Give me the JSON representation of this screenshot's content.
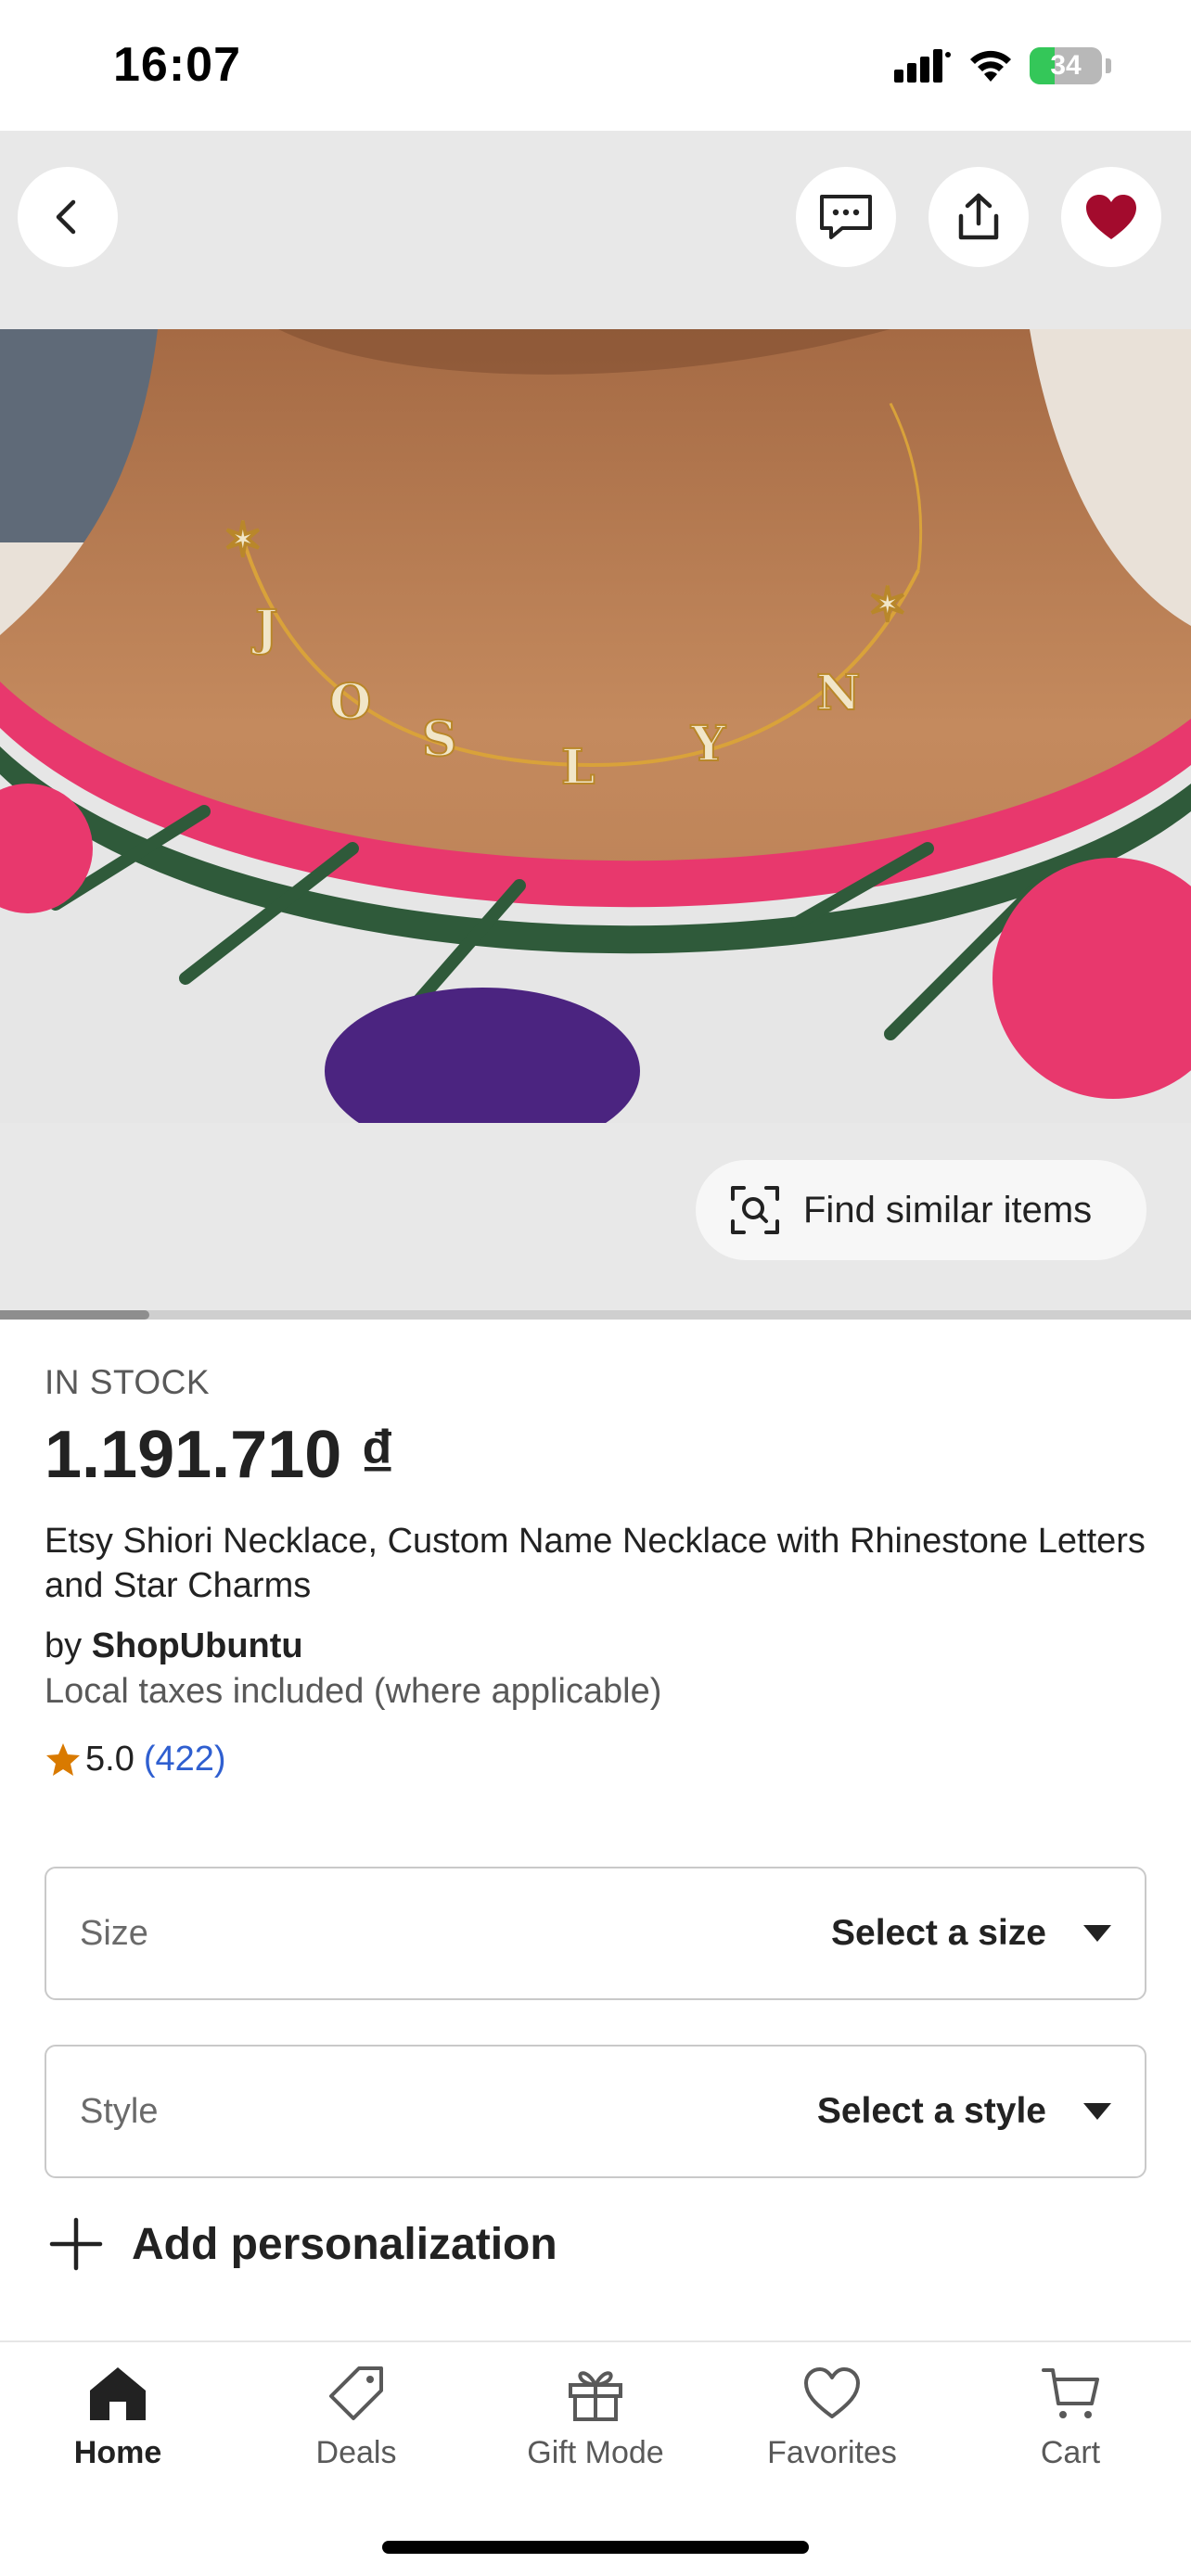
{
  "status_bar": {
    "time": "16:07",
    "battery_text": "34",
    "battery_level": 0.34,
    "icons": [
      "signal-icon",
      "wifi-icon",
      "battery-icon"
    ]
  },
  "gallery": {
    "top_actions": [
      "back-icon",
      "message-icon",
      "share-icon",
      "favorite-heart-icon"
    ],
    "find_similar_label": "Find similar items",
    "image_progress": 0.125
  },
  "product": {
    "stock": "IN STOCK",
    "price": "1.191.710 ₫",
    "title": "Etsy Shiori Necklace, Custom Name Necklace with Rhinestone Letters and Star Charms",
    "by_prefix": "by",
    "shop": "ShopUbuntu",
    "taxes": "Local taxes included (where applicable)",
    "rating": "5.0",
    "review_count": "(422)"
  },
  "options": {
    "size_label": "Size",
    "size_value": "Select a size",
    "style_label": "Style",
    "style_value": "Select a style",
    "personalization_label": "Add personalization"
  },
  "tabs": [
    {
      "label": "Home",
      "icon": "home-icon",
      "active": true
    },
    {
      "label": "Deals",
      "icon": "tag-icon",
      "active": false
    },
    {
      "label": "Gift Mode",
      "icon": "gift-icon",
      "active": false
    },
    {
      "label": "Favorites",
      "icon": "heart-outline-icon",
      "active": false
    },
    {
      "label": "Cart",
      "icon": "cart-icon",
      "active": false
    }
  ],
  "colors": {
    "favorite_red": "#a30b2d",
    "star": "#d97a00",
    "link_blue": "#2f5fd0",
    "battery_green": "#34c759"
  }
}
